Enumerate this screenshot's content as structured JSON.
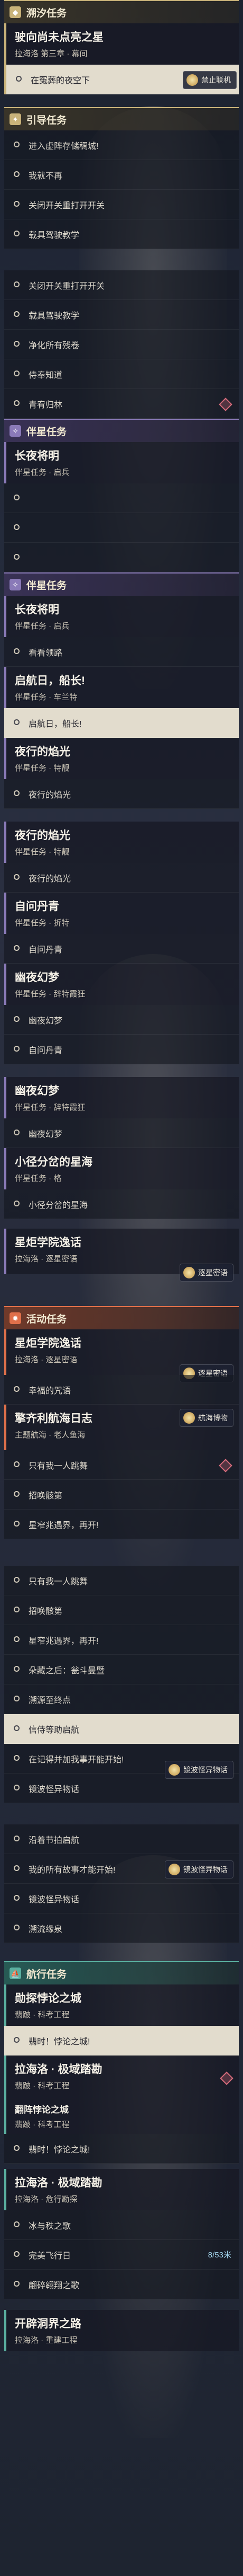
{
  "colors": {
    "gold": "#c9b37a",
    "guide": "#8a7ab8",
    "event": "#e0704a",
    "travel": "#5ab0a0",
    "rose": "#d46a7a"
  },
  "b1": {
    "head": "溯汐任务",
    "title": "驶向尚未点亮之星",
    "sub": "拉海洛 第三章 · 幕间",
    "step": "在冤葬的夜空下",
    "tag": "禁止联机"
  },
  "b2": {
    "head": "引导任务",
    "steps": [
      "进入虚阵存储稠城!",
      "我就不再",
      "关闭开关重打开开关",
      "载具驾驶教学",
      "",
      "关闭开关重打开开关",
      "载具驾驶教学",
      "净化所有残卷",
      "侍奉知道",
      "青宥归林"
    ]
  },
  "b3": {
    "head": "伴星任务",
    "t1": "长夜将明",
    "s1": "伴星任务 · 启兵",
    "steps1": [
      "",
      "",
      ""
    ]
  },
  "b3b": {
    "t1": "长夜将明",
    "s1": "伴星任务 · 启兵",
    "st1": "看看领路",
    "t2": "启航日，船长!",
    "s2": "伴星任务 · 车兰特",
    "st2": "启航日，船长!",
    "t3": "夜行的焰光",
    "s3": "伴星任务 · 特靓",
    "st3": "夜行的焰光",
    "t4": "夜行的焰光",
    "s4": "伴星任务 · 特靓",
    "st4": "夜行的焰光",
    "t5": "自问丹青",
    "s5": "伴星任务 · 折特",
    "st5": "自问丹青",
    "t6": "幽夜幻梦",
    "s6": "伴星任务 · 辞特霞狂",
    "st6": "幽夜幻梦",
    "st7": "自问丹青",
    "t8": "幽夜幻梦",
    "s8": "伴星任务 · 辞特霞狂",
    "st8": "幽夜幻梦",
    "t9": "小径分岔的星海",
    "s9": "伴星任务 · 格",
    "st9": "小径分岔的星海",
    "t10": "星炬学院逸话",
    "s10": "拉海洛 · 逐星密语",
    "tag10": "逐星密语"
  },
  "b4": {
    "head": "活动任务",
    "t1": "星炬学院逸话",
    "s1": "拉海洛 · 逐星密语",
    "tag1": "逐星密语",
    "st1": "幸福的咒语",
    "t2": "擎齐利航海日志",
    "s2": "主题航海 · 老人鱼海",
    "tag2": "航海博物",
    "steps2": [
      "只有我一人跳舞",
      "招唤骸第",
      "星窄兆遇界，再开!"
    ],
    "steps3": [
      "只有我一人跳舞",
      "招唤骸第",
      "星窄兆遇界，再开!",
      "朵藏之后：瓮斗曼暨",
      "溯源至终点",
      "信侍等助启航",
      "在记得并加我事开能开始!",
      "镜波怪异物话"
    ],
    "tag3": "镜波怪异物话",
    "steps4": [
      "沿着节拍启航",
      "我的所有故事才能开始!",
      "镜波怪异物话",
      "溯流缘泉"
    ],
    "tag4": "镜波怪异物话"
  },
  "b5": {
    "head": "航行任务",
    "t1": "勋探悖论之城",
    "s1": "翡跛 · 科考工程",
    "st1": "翡时！悖论之城!",
    "t2": "拉海洛 · 极域踏勘",
    "s2": "翡跛 · 科考工程",
    "t3": "翻阵悖论之城",
    "s3": "翡跛 · 科考工程",
    "st3": "翡时！悖论之城!",
    "t4": "拉海洛 · 极域踏勘",
    "s4": "拉海洛 · 危行勘探",
    "st4a": "冰与秩之歌",
    "st4b": "完美飞行日",
    "st4b_num": "8/53米",
    "st4c": "翩碎翱翔之歌",
    "t5": "开辟洞界之路",
    "s5": "拉海洛 · 重建工程"
  }
}
